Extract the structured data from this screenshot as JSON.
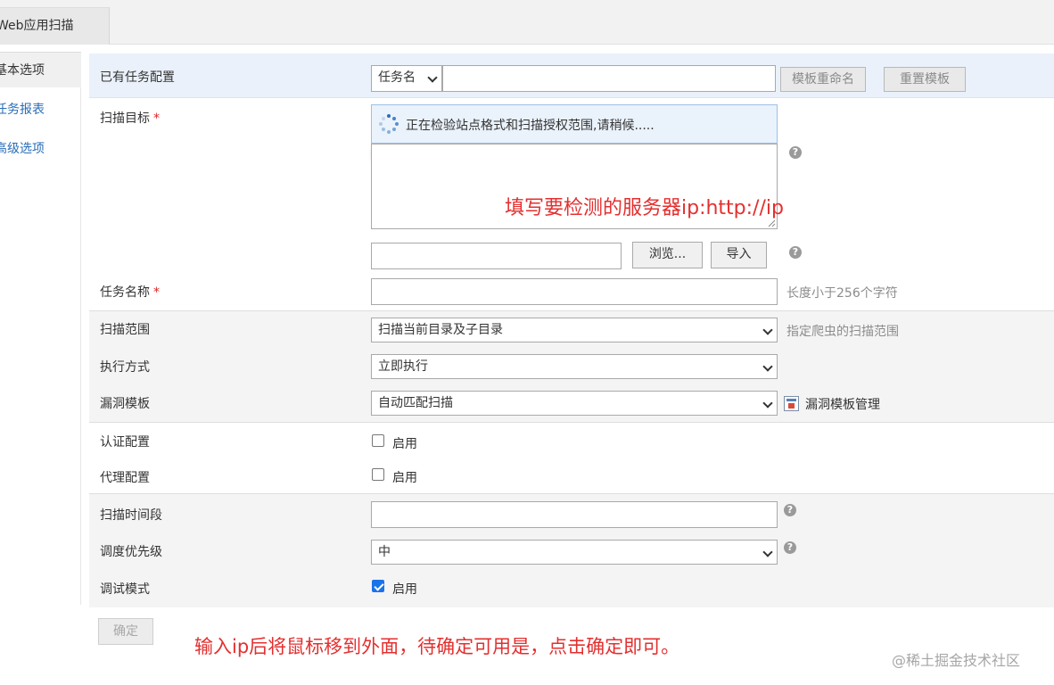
{
  "app": {
    "tab_title": "Web应用扫描"
  },
  "sidebar": {
    "items": [
      {
        "label": "基本选项"
      },
      {
        "label": "任务报表"
      },
      {
        "label": "高级选项"
      }
    ]
  },
  "form": {
    "existing_config": {
      "label": "已有任务配置",
      "select_value": "任务名",
      "rename_button": "模板重命名",
      "reset_button": "重置模板"
    },
    "scan_target": {
      "label": "扫描目标",
      "required_mark": "*",
      "loading_text": "正在检验站点格式和扫描授权范围,请稍候.....",
      "browse_button": "浏览...",
      "import_button": "导入"
    },
    "task_name": {
      "label": "任务名称",
      "required_mark": "*",
      "hint": "长度小于256个字符"
    },
    "scan_scope": {
      "label": "扫描范围",
      "value": "扫描当前目录及子目录",
      "hint": "指定爬虫的扫描范围"
    },
    "exec_mode": {
      "label": "执行方式",
      "value": "立即执行"
    },
    "vuln_template": {
      "label": "漏洞模板",
      "value": "自动匹配扫描",
      "manage_link": "漏洞模板管理"
    },
    "auth_config": {
      "label": "认证配置",
      "checkbox_label": "启用",
      "checked": false
    },
    "proxy_config": {
      "label": "代理配置",
      "checkbox_label": "启用",
      "checked": false
    },
    "scan_time": {
      "label": "扫描时间段",
      "value": ""
    },
    "priority": {
      "label": "调度优先级",
      "value": "中"
    },
    "debug_mode": {
      "label": "调试模式",
      "checkbox_label": "启用",
      "checked": true
    },
    "help_glyph": "?",
    "confirm_button": "确定"
  },
  "annotations": {
    "target_hint": "填写要检测的服务器ip:http://ip",
    "bottom_hint": "输入ip后将鼠标移到外面，待确定可用是，点击确定即可。"
  },
  "watermark": "@稀土掘金技术社区",
  "colors": {
    "annotation_red": "#e42f2f",
    "link_blue": "#2a6db8",
    "highlight_row": "#eaf1fa",
    "checkbox_blue": "#1a73e8"
  }
}
